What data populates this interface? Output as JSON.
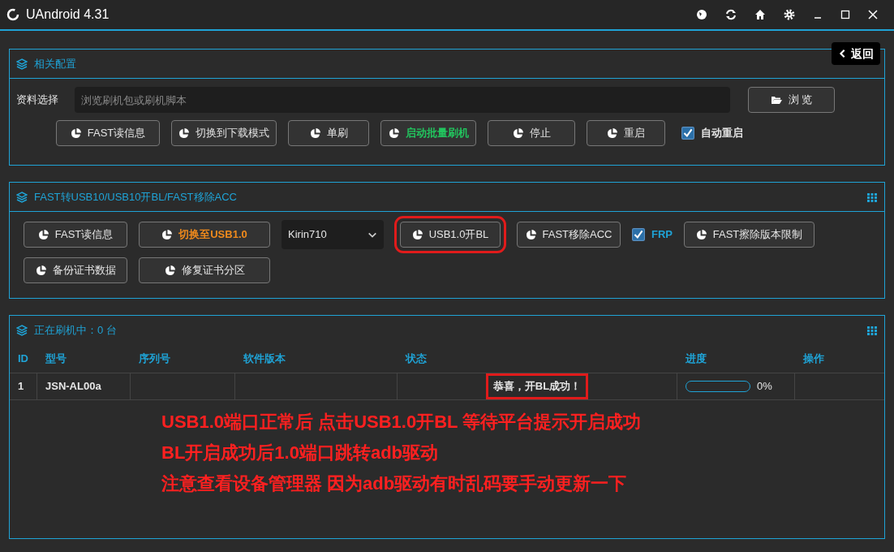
{
  "window": {
    "title": "UAndroid 4.31"
  },
  "back_button": {
    "label": "返回"
  },
  "config_panel": {
    "title": "相关配置",
    "file_label": "资料选择",
    "file_placeholder": "浏览刷机包或刷机脚本",
    "browse_button": "浏 览",
    "buttons": [
      {
        "label": "FAST读信息"
      },
      {
        "label": "切换到下载模式"
      },
      {
        "label": "单刷"
      },
      {
        "label": "启动批量刷机",
        "color": "#22c55e"
      },
      {
        "label": "停止"
      },
      {
        "label": "重启"
      }
    ],
    "auto_restart": {
      "label": "自动重启",
      "checked": true
    }
  },
  "fast_panel": {
    "title": "FAST转USB10/USB10开BL/FAST移除ACC",
    "items": [
      {
        "kind": "button",
        "label": "FAST读信息",
        "highlighted": false
      },
      {
        "kind": "button",
        "label": "切换至USB1.0",
        "color": "#f08a1c",
        "highlighted": false
      },
      {
        "kind": "select",
        "label": "Kirin710"
      },
      {
        "kind": "button",
        "label": "USB1.0开BL",
        "highlighted": true
      },
      {
        "kind": "button",
        "label": "FAST移除ACC",
        "highlighted": false
      },
      {
        "kind": "checkbox",
        "label": "FRP",
        "checked": true
      },
      {
        "kind": "button",
        "label": "FAST擦除版本限制",
        "highlighted": false
      },
      {
        "kind": "button",
        "label": "备份证书数据",
        "highlighted": false
      },
      {
        "kind": "button",
        "label": "修复证书分区",
        "highlighted": false
      }
    ]
  },
  "devices_panel": {
    "title": "正在刷机中：0 台",
    "table": {
      "columns": [
        "ID",
        "型号",
        "序列号",
        "软件版本",
        "状态",
        "进度",
        "操作"
      ],
      "rows": [
        {
          "id": "1",
          "model": "JSN-AL00a",
          "status": "恭喜，开BL成功！",
          "status_highlighted": true,
          "level": 0,
          "progress": "0%"
        }
      ]
    }
  },
  "annotations": [
    "USB1.0端口正常后 点击USB1.0开BL 等待平台提示开启成功",
    "BL开启成功后1.0端口跳转adb驱动",
    "注意查看设备管理器 因为adb驱动有时乱码要手动更新一下"
  ]
}
